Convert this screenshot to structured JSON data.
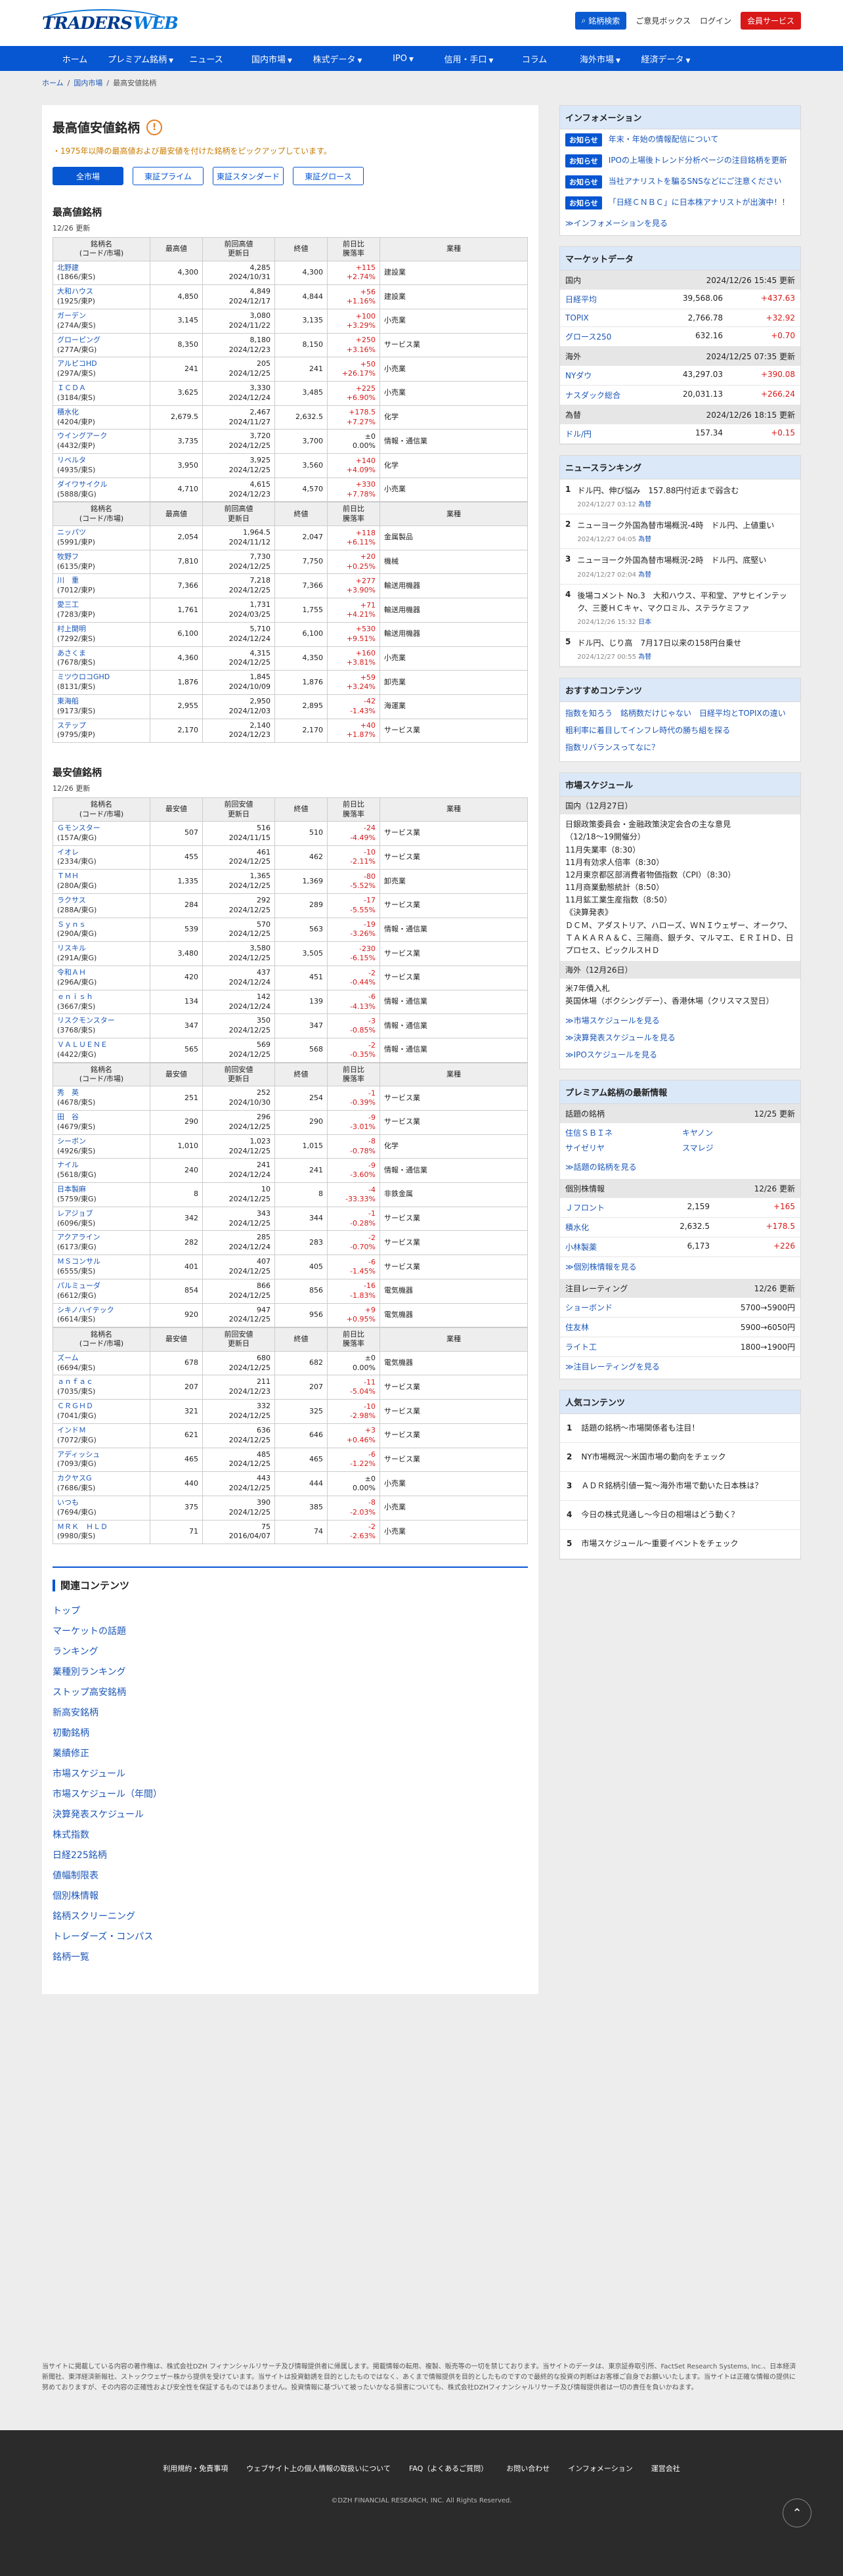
{
  "header": {
    "logo_text": "TRADERS",
    "logo_suffix": "WEB",
    "search_btn": "銘柄検索",
    "links": [
      "ご意見ボックス",
      "ログイン"
    ],
    "register": "会員サービス"
  },
  "nav": [
    "ホーム",
    "プレミアム銘柄",
    "ニュース",
    "国内市場",
    "株式データ",
    "IPO",
    "信用・手口",
    "コラム",
    "海外市場",
    "経済データ"
  ],
  "crumb": [
    "ホーム",
    "国内市場",
    "最高安値銘柄"
  ],
  "page": {
    "title": "最高値安値銘柄",
    "note": "・1975年以降の最高値および最安値を付けた銘柄をピックアップしています。",
    "tabs": [
      "全市場",
      "東証プライム",
      "東証スタンダード",
      "東証グロース"
    ]
  },
  "table_headers": [
    "銘柄名\n(コード/市場)",
    "最高値",
    "前回高値\n更新日",
    "終値",
    "前日比\n騰落率",
    "業種"
  ],
  "low_headers": [
    "銘柄名\n(コード/市場)",
    "最安値",
    "前回安値\n更新日",
    "終値",
    "前日比\n騰落率",
    "業種"
  ],
  "high": {
    "title": "最高値銘柄",
    "updated": "12/26 更新",
    "groups": [
      [
        [
          "北野建",
          "1866/東S",
          "4,300",
          "4,285",
          "2024/10/31",
          "4,300",
          "+115",
          "+2.74%",
          "建設業"
        ],
        [
          "大和ハウス",
          "1925/東P",
          "4,850",
          "4,849",
          "2024/12/17",
          "4,844",
          "+56",
          "+1.16%",
          "建設業"
        ],
        [
          "ガーデン",
          "274A/東S",
          "3,145",
          "3,080",
          "2024/11/22",
          "3,135",
          "+100",
          "+3.29%",
          "小売業"
        ],
        [
          "グローピング",
          "277A/東G",
          "8,350",
          "8,180",
          "2024/12/23",
          "8,150",
          "+250",
          "+3.16%",
          "サービス業"
        ],
        [
          "アルピコHD",
          "297A/東S",
          "241",
          "205",
          "2024/12/25",
          "241",
          "+50",
          "+26.17%",
          "小売業"
        ],
        [
          "ＩＣＤＡ",
          "3184/東S",
          "3,625",
          "3,330",
          "2024/12/24",
          "3,485",
          "+225",
          "+6.90%",
          "小売業"
        ],
        [
          "積水化",
          "4204/東P",
          "2,679.5",
          "2,467",
          "2024/11/27",
          "2,632.5",
          "+178.5",
          "+7.27%",
          "化学"
        ],
        [
          "ウイングアーク",
          "4432/東P",
          "3,735",
          "3,720",
          "2024/12/25",
          "3,700",
          "±0",
          "0.00%",
          "情報・通信業"
        ],
        [
          "リベルタ",
          "4935/東S",
          "3,950",
          "3,925",
          "2024/12/25",
          "3,560",
          "+140",
          "+4.09%",
          "化学"
        ],
        [
          "ダイワサイクル",
          "5888/東G",
          "4,710",
          "4,615",
          "2024/12/23",
          "4,570",
          "+330",
          "+7.78%",
          "小売業"
        ]
      ],
      [
        [
          "ニッパツ",
          "5991/東P",
          "2,054",
          "1,964.5",
          "2024/11/12",
          "2,047",
          "+118",
          "+6.11%",
          "金属製品"
        ],
        [
          "牧野フ",
          "6135/東P",
          "7,810",
          "7,730",
          "2024/12/25",
          "7,750",
          "+20",
          "+0.25%",
          "機械"
        ],
        [
          "川　重",
          "7012/東P",
          "7,366",
          "7,218",
          "2024/12/25",
          "7,366",
          "+277",
          "+3.90%",
          "輸送用機器"
        ],
        [
          "愛三工",
          "7283/東P",
          "1,761",
          "1,731",
          "2024/03/25",
          "1,755",
          "+71",
          "+4.21%",
          "輸送用機器"
        ],
        [
          "村上開明",
          "7292/東S",
          "6,100",
          "5,710",
          "2024/12/24",
          "6,100",
          "+530",
          "+9.51%",
          "輸送用機器"
        ],
        [
          "あさくま",
          "7678/東S",
          "4,360",
          "4,315",
          "2024/12/25",
          "4,350",
          "+160",
          "+3.81%",
          "小売業"
        ],
        [
          "ミツウロコGHD",
          "8131/東S",
          "1,876",
          "1,845",
          "2024/10/09",
          "1,876",
          "+59",
          "+3.24%",
          "卸売業"
        ],
        [
          "東海船",
          "9173/東S",
          "2,955",
          "2,950",
          "2024/12/03",
          "2,895",
          "-42",
          "-1.43%",
          "海運業"
        ],
        [
          "ステップ",
          "9795/東P",
          "2,170",
          "2,140",
          "2024/12/23",
          "2,170",
          "+40",
          "+1.87%",
          "サービス業"
        ]
      ]
    ]
  },
  "low": {
    "title": "最安値銘柄",
    "updated": "12/26 更新",
    "groups": [
      [
        [
          "Ｇモンスター",
          "157A/東G",
          "507",
          "516",
          "2024/11/15",
          "510",
          "-24",
          "-4.49%",
          "サービス業"
        ],
        [
          "イオレ",
          "2334/東G",
          "455",
          "461",
          "2024/12/25",
          "462",
          "-10",
          "-2.11%",
          "サービス業"
        ],
        [
          "ＴＭＨ",
          "280A/東G",
          "1,335",
          "1,365",
          "2024/12/25",
          "1,369",
          "-80",
          "-5.52%",
          "卸売業"
        ],
        [
          "ラクサス",
          "288A/東G",
          "284",
          "292",
          "2024/12/25",
          "289",
          "-17",
          "-5.55%",
          "サービス業"
        ],
        [
          "Ｓｙｎｓ",
          "290A/東G",
          "539",
          "570",
          "2024/12/25",
          "563",
          "-19",
          "-3.26%",
          "情報・通信業"
        ],
        [
          "リスキル",
          "291A/東G",
          "3,480",
          "3,580",
          "2024/12/25",
          "3,505",
          "-230",
          "-6.15%",
          "サービス業"
        ],
        [
          "令和ＡＨ",
          "296A/東G",
          "420",
          "437",
          "2024/12/24",
          "451",
          "-2",
          "-0.44%",
          "サービス業"
        ],
        [
          "ｅｎｉｓｈ",
          "3667/東S",
          "134",
          "142",
          "2024/12/24",
          "139",
          "-6",
          "-4.13%",
          "情報・通信業"
        ],
        [
          "リスクモンスター",
          "3768/東S",
          "347",
          "350",
          "2024/12/25",
          "347",
          "-3",
          "-0.85%",
          "情報・通信業"
        ],
        [
          "ＶＡＬＵＥＮＥ",
          "4422/東G",
          "565",
          "569",
          "2024/12/25",
          "568",
          "-2",
          "-0.35%",
          "情報・通信業"
        ]
      ],
      [
        [
          "秀　英",
          "4678/東S",
          "251",
          "252",
          "2024/10/30",
          "254",
          "-1",
          "-0.39%",
          "サービス業"
        ],
        [
          "田　谷",
          "4679/東S",
          "290",
          "296",
          "2024/12/25",
          "290",
          "-9",
          "-3.01%",
          "サービス業"
        ],
        [
          "シーボン",
          "4926/東S",
          "1,010",
          "1,023",
          "2024/12/25",
          "1,015",
          "-8",
          "-0.78%",
          "化学"
        ],
        [
          "ナイル",
          "5618/東G",
          "240",
          "241",
          "2024/12/24",
          "241",
          "-9",
          "-3.60%",
          "情報・通信業"
        ],
        [
          "日本製麻",
          "5759/東G",
          "8",
          "10",
          "2024/12/25",
          "8",
          "-4",
          "-33.33%",
          "非鉄金属"
        ],
        [
          "レアジョブ",
          "6096/東S",
          "342",
          "343",
          "2024/12/25",
          "344",
          "-1",
          "-0.28%",
          "サービス業"
        ],
        [
          "アクアライン",
          "6173/東G",
          "282",
          "285",
          "2024/12/24",
          "283",
          "-2",
          "-0.70%",
          "サービス業"
        ],
        [
          "ＭＳコンサル",
          "6555/東S",
          "401",
          "407",
          "2024/12/25",
          "405",
          "-6",
          "-1.45%",
          "サービス業"
        ],
        [
          "パルミューダ",
          "6612/東G",
          "854",
          "866",
          "2024/12/25",
          "856",
          "-16",
          "-1.83%",
          "電気機器"
        ],
        [
          "シキノハイテック",
          "6614/東S",
          "920",
          "947",
          "2024/12/25",
          "956",
          "+9",
          "+0.95%",
          "電気機器"
        ]
      ],
      [
        [
          "ズーム",
          "6694/東S",
          "678",
          "680",
          "2024/12/25",
          "682",
          "±0",
          "0.00%",
          "電気機器"
        ],
        [
          "ａｎｆａｃ",
          "7035/東S",
          "207",
          "211",
          "2024/12/23",
          "207",
          "-11",
          "-5.04%",
          "サービス業"
        ],
        [
          "ＣＲＧＨＤ",
          "7041/東G",
          "321",
          "332",
          "2024/12/25",
          "325",
          "-10",
          "-2.98%",
          "サービス業"
        ],
        [
          "インドＭ",
          "7072/東G",
          "621",
          "636",
          "2024/12/25",
          "646",
          "+3",
          "+0.46%",
          "サービス業"
        ],
        [
          "アディッシュ",
          "7093/東G",
          "465",
          "485",
          "2024/12/25",
          "465",
          "-6",
          "-1.22%",
          "サービス業"
        ],
        [
          "カクヤスG",
          "7686/東S",
          "440",
          "443",
          "2024/12/25",
          "444",
          "±0",
          "0.00%",
          "小売業"
        ],
        [
          "いつも",
          "7694/東G",
          "375",
          "390",
          "2024/12/25",
          "385",
          "-8",
          "-2.03%",
          "小売業"
        ],
        [
          "ＭＲＫ　ＨＬＤ",
          "9980/東S",
          "71",
          "75",
          "2016/04/07",
          "74",
          "-2",
          "-2.63%",
          "小売業"
        ]
      ]
    ]
  },
  "related": {
    "title": "関連コンテンツ",
    "links": [
      "トップ",
      "マーケットの話題",
      "ランキング",
      "業種別ランキング",
      "ストップ高安銘柄",
      "新高安銘柄",
      "初動銘柄",
      "業績修正",
      "市場スケジュール",
      "市場スケジュール（年間）",
      "決算発表スケジュール",
      "株式指数",
      "日経225銘柄",
      "値幅制限表",
      "個別株情報",
      "銘柄スクリーニング",
      "トレーダーズ・コンパス",
      "銘柄一覧"
    ]
  },
  "side": {
    "info": {
      "title": "インフォメーション",
      "badge": "お知らせ",
      "items": [
        "年末・年始の情報配信について",
        "IPOの上場後トレンド分析ページの注目銘柄を更新",
        "当社アナリストを騙るSNSなどにご注意ください",
        "「日経ＣＮＢＣ」に日本株アナリストが出演中！！"
      ],
      "more": "≫インフォメーションを見る"
    },
    "market": {
      "title": "マーケットデータ",
      "sections": [
        {
          "label": "国内",
          "time": "2024/12/26 15:45 更新",
          "rows": [
            [
              "日経平均",
              "39,568.06",
              "+437.63"
            ],
            [
              "TOPIX",
              "2,766.78",
              "+32.92"
            ],
            [
              "グロース250",
              "632.16",
              "+0.70"
            ]
          ]
        },
        {
          "label": "海外",
          "time": "2024/12/25 07:35 更新",
          "rows": [
            [
              "NYダウ",
              "43,297.03",
              "+390.08"
            ],
            [
              "ナスダック総合",
              "20,031.13",
              "+266.24"
            ]
          ]
        },
        {
          "label": "為替",
          "time": "2024/12/26 18:15 更新",
          "rows": [
            [
              "ドル/円",
              "157.34",
              "+0.15"
            ]
          ]
        }
      ]
    },
    "news": {
      "title": "ニュースランキング",
      "items": [
        [
          "ドル円、伸び悩み　157.88円付近まで弱含む",
          "2024/12/27 03:12",
          "為替"
        ],
        [
          "ニューヨーク外国為替市場概況-4時　ドル円、上値重い",
          "2024/12/27 04:05",
          "為替"
        ],
        [
          "ニューヨーク外国為替市場概況-2時　ドル円、底堅い",
          "2024/12/27 02:04",
          "為替"
        ],
        [
          "後場コメント No.3　大和ハウス、平和堂、アサヒインテック、三菱ＨＣキャ、マクロミル、ステラケミファ",
          "2024/12/26 15:32",
          "日本"
        ],
        [
          "ドル円、じり高　7月17日以来の158円台乗せ",
          "2024/12/27 00:55",
          "為替"
        ]
      ]
    },
    "rec": {
      "title": "おすすめコンテンツ",
      "links": [
        "指数を知ろう　銘柄数だけじゃない　日経平均とTOPIXの違い",
        "粗利率に着目してインフレ時代の勝ち組を探る",
        "指数リバランスってなに？"
      ]
    },
    "sched": {
      "title": "市場スケジュール",
      "jp_label": "国内（12月27日）",
      "jp_body": [
        "日銀政策委員会・金融政策決定会合の主な意見",
        "（12/18〜19開催分）",
        "11月失業率（8:30）",
        "11月有効求人倍率（8:30）",
        "12月東京都区部消費者物価指数（CPI）（8:30）",
        "11月商業動態統計（8:50）",
        "11月鉱工業生産指数（8:50）",
        "《決算発表》",
        "ＤＣＭ、アダストリア、ハローズ、ＷＮＩウェザー、オークワ、ＴＡＫＡＲＡ＆Ｃ、三陽商、銀チタ、マルマエ、ＥＲＩＨＤ、日プロセス、ピックルスＨＤ"
      ],
      "ov_label": "海外（12月26日）",
      "ov_body": [
        "米7年債入札",
        "英国休場（ボクシングデー）、香港休場（クリスマス翌日）"
      ],
      "links": [
        "≫市場スケジュールを見る",
        "≫決算発表スケジュールを見る",
        "≫IPOスケジュールを見る"
      ]
    },
    "prem": {
      "title": "プレミアム銘柄の最新情報",
      "topic_label": "話題の銘柄",
      "topic_time": "12/25 更新",
      "topics": [
        "住信ＳＢＩネ",
        "キヤノン",
        "サイゼリヤ",
        "スマレジ"
      ],
      "topic_more": "≫話題の銘柄を見る",
      "kabu_label": "個別株情報",
      "kabu_time": "12/26 更新",
      "kabu": [
        [
          "Ｊフロント",
          "2,159",
          "+165"
        ],
        [
          "積水化",
          "2,632.5",
          "+178.5"
        ],
        [
          "小林製薬",
          "6,173",
          "+226"
        ]
      ],
      "kabu_more": "≫個別株情報を見る",
      "rating_label": "注目レーティング",
      "rating_time": "12/26 更新",
      "rating": [
        [
          "ショーボンド",
          "5700→5900円"
        ],
        [
          "住友林",
          "5900→6050円"
        ],
        [
          "ライト工",
          "1800→1900円"
        ]
      ],
      "rating_more": "≫注目レーティングを見る"
    },
    "pop": {
      "title": "人気コンテンツ",
      "items": [
        "話題の銘柄〜市場関係者も注目！",
        "NY市場概況〜米国市場の動向をチェック",
        "ＡＤＲ銘柄引値一覧〜海外市場で動いた日本株は？",
        "今日の株式見通し〜今日の相場はどう動く？",
        "市場スケジュール〜重要イベントをチェック"
      ]
    }
  },
  "disclaimer": "当サイトに掲載している内容の著作権は、株式会社DZH フィナンシャルリサーチ及び情報提供者に帰属します。掲載情報の転用、複製、販売等の一切を禁じております。当サイトのデータは、東京証券取引所、FactSet Research Systems, Inc.、日本経済新聞社、東洋経済新報社、ストックウェザー株から提供を受けています。当サイトは投資勧誘を目的としたものではなく、あくまで情報提供を目的としたものですので最終的な投資の判断はお客様ご自身でお願いいたします。当サイトは正確な情報の提供に努めておりますが、その内容の正確性および安全性を保証するものではありません。投資情報に基づいて被ったいかなる損害についても、株式会社DZHフィナンシャルリサーチ及び情報提供者は一切の責任を負いかねます。",
  "footer": {
    "links": [
      "利用規約・免責事項",
      "ウェブサイト上の個人情報の取扱いについて",
      "FAQ（よくあるご質問）",
      "お問い合わせ",
      "インフォメーション",
      "運営会社"
    ],
    "copy": "©DZH FINANCIAL RESEARCH, INC. All Rights Reserved."
  }
}
